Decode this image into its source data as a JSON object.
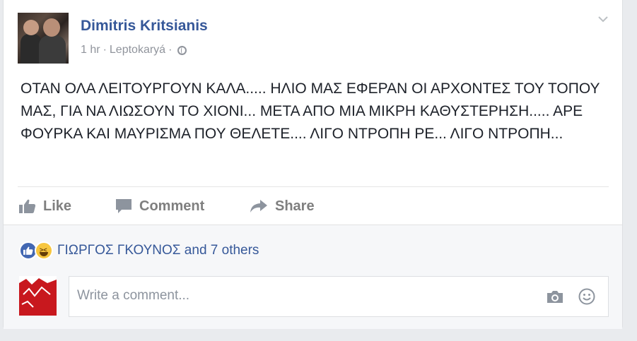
{
  "post": {
    "author": "Dimitris Kritsianis",
    "time": "1 hr",
    "separator": "·",
    "location": "Leptokaryá",
    "text": "ΟΤΑΝ ΟΛΑ ΛΕΙΤΟΥΡΓΟΥΝ ΚΑΛΑ..... ΗΛΙΟ ΜΑΣ ΕΦΕΡΑΝ ΟΙ ΑΡΧΟΝΤΕΣ ΤΟΥ ΤΟΠΟΥ ΜΑΣ, ΓΙΑ ΝΑ ΛΙΩΣΟΥΝ ΤΟ ΧΙΟΝΙ... ΜΕΤΑ ΑΠΟ ΜΙΑ ΜΙΚΡΗ ΚΑΘΥΣΤΕΡΗΣΗ..... ΑΡΕ ΦΟΥΡΚΑ ΚΑΙ ΜΑΥΡΙΣΜΑ ΠΟΥ ΘΕΛΕΤΕ.... ΛΙΓΟ ΝΤΡΟΠΗ ΡΕ... ΛΙΓΟ ΝΤΡΟΠΗ..."
  },
  "actions": {
    "like_label": "Like",
    "comment_label": "Comment",
    "share_label": "Share"
  },
  "reactions": {
    "summary": "ΓΙΩΡΓΟΣ ΓΚΟΥΝΟΣ and 7 others"
  },
  "comment_input": {
    "placeholder": "Write a comment..."
  },
  "colors": {
    "link": "#365899",
    "like_blue": "#4267b2",
    "haha_yellow": "#f7c63f",
    "commenter_avatar_red": "#c8181e"
  },
  "icons": [
    "chevron-down-icon",
    "globe-icon",
    "thumbs-up-icon",
    "comment-icon",
    "share-icon",
    "like-reaction-icon",
    "haha-reaction-icon",
    "camera-icon",
    "smiley-icon"
  ]
}
